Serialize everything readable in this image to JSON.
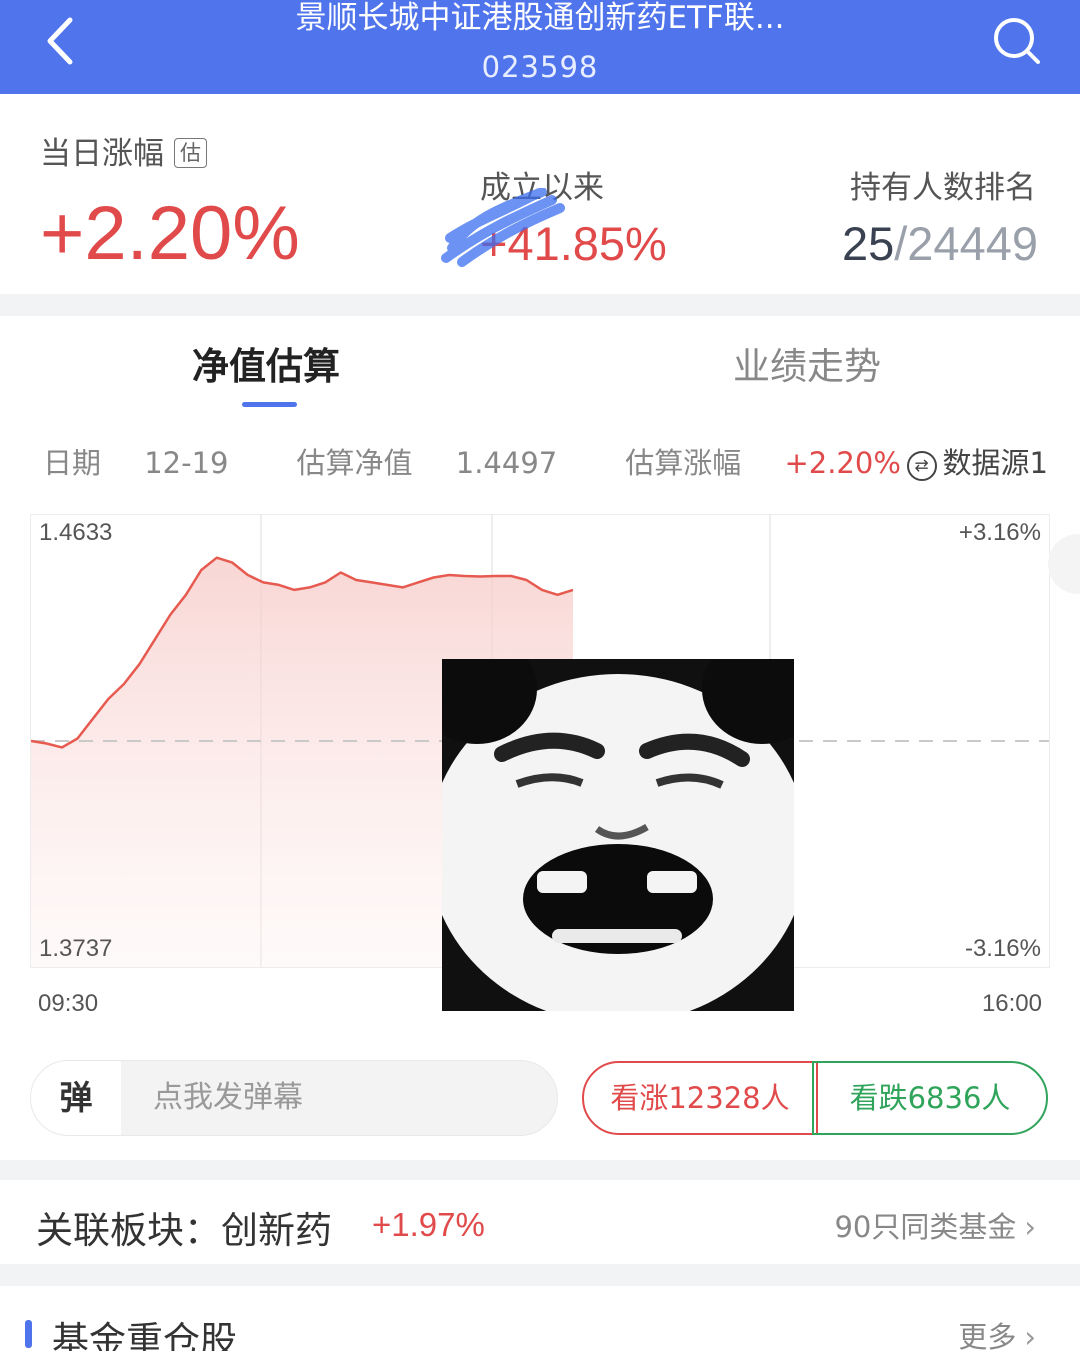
{
  "header": {
    "title": "景顺长城中证港股通创新药ETF联...",
    "code": "023598"
  },
  "summary": {
    "daily_change_label": "当日涨幅",
    "estimate_tag": "估",
    "daily_change_value": "+2.20%",
    "since_inception_label": "成立以来",
    "since_inception_value": "+41.85%",
    "holder_rank_label": "持有人数排名",
    "holder_rank": "25",
    "holder_rank_total": "/24449"
  },
  "tabs": {
    "nav_estimate": "净值估算",
    "performance_trend": "业绩走势"
  },
  "estimate_info": {
    "date_label": "日期",
    "date": "12-19",
    "nav_label": "估算净值",
    "nav": "1.4497",
    "change_label": "估算涨幅",
    "change": "+2.20%",
    "data_source": "数据源1",
    "source_icon": "⇄"
  },
  "chart_data": {
    "type": "line",
    "y_left_max": "1.4633",
    "y_left_min": "1.3737",
    "y_right_max": "+3.16%",
    "y_right_min": "-3.16%",
    "x_start": "09:30",
    "x_end": "16:00",
    "baseline_nav": 1.4185,
    "ylim": [
      1.3737,
      1.4633
    ],
    "series": [
      {
        "values": [
          1.4185,
          1.418,
          1.4172,
          1.419,
          1.423,
          1.427,
          1.43,
          1.434,
          1.439,
          1.444,
          1.448,
          1.453,
          1.4555,
          1.4545,
          1.452,
          1.4505,
          1.45,
          1.449,
          1.4495,
          1.4505,
          1.4525,
          1.451,
          1.4505,
          1.45,
          1.4495,
          1.4505,
          1.4515,
          1.452,
          1.4518,
          1.4517,
          1.4518,
          1.4518,
          1.451,
          1.449,
          1.448,
          1.449
        ]
      }
    ]
  },
  "danmu": {
    "button": "弹",
    "placeholder": "点我发弹幕"
  },
  "votes": {
    "bullish": "看涨12328人",
    "bearish": "看跌6836人"
  },
  "sector": {
    "label": "关联板块：创新药",
    "change": "+1.97%",
    "peers": "90只同类基金"
  },
  "holdings": {
    "title": "基金重仓股",
    "more": "更多"
  },
  "colors": {
    "brand_blue": "#4f74ec",
    "up_red": "#e14a4a",
    "down_green": "#2fa45a"
  }
}
